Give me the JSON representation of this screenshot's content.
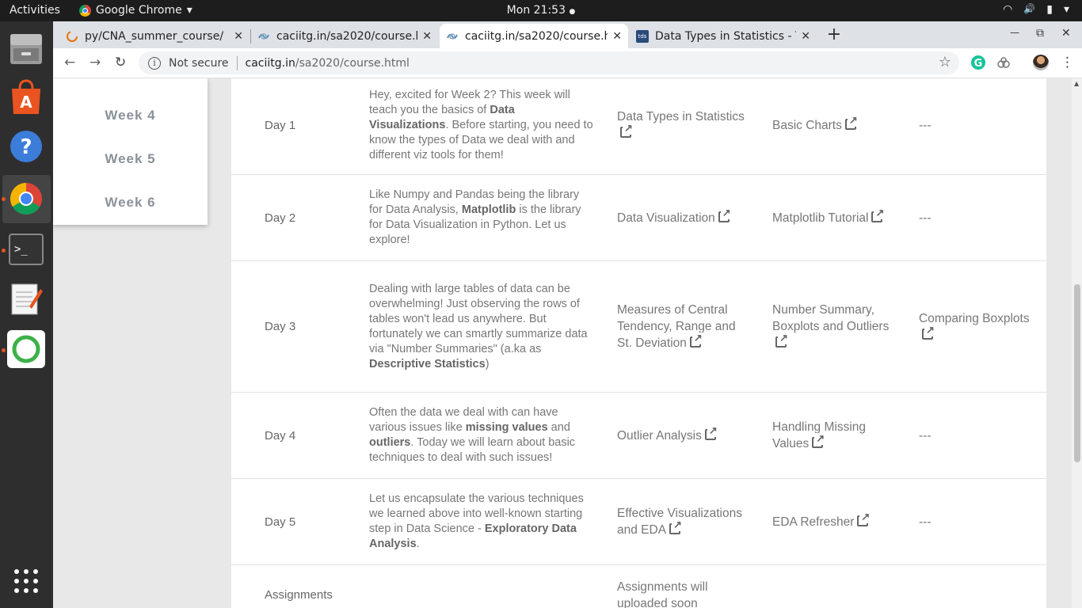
{
  "topbar": {
    "activities": "Activities",
    "app_name": "Google Chrome",
    "app_arrow": "▾",
    "clock": "Mon 21:53",
    "dot": "●",
    "wifi": "◠",
    "volume": "🔊",
    "battery": "▮",
    "menu": "▾"
  },
  "dock": {
    "items": [
      "files-icon",
      "software-center-icon",
      "help-icon",
      "chrome-icon",
      "terminal-icon",
      "text-editor-icon",
      "anaconda-icon"
    ],
    "apps_grid": "⋮⋮⋮"
  },
  "tabs": [
    {
      "title": "py/CNA_summer_course/",
      "close": "✕"
    },
    {
      "title": "caciitg.in/sa2020/course.h",
      "close": "✕"
    },
    {
      "title": "caciitg.in/sa2020/course.h",
      "close": "✕"
    },
    {
      "title": "Data Types in Statistics - T",
      "close": "✕",
      "favicon_text": "tds"
    }
  ],
  "window": {
    "new_tab": "+",
    "minimize": "—",
    "maximize": "⧉",
    "close": "✕"
  },
  "toolbar": {
    "back": "←",
    "forward": "→",
    "reload": "↻",
    "info": "i",
    "not_secure": "Not secure",
    "url_host": "caciitg.in",
    "url_path": "/sa2020/course.html",
    "star": "☆",
    "menu": "⋮"
  },
  "sidebar": {
    "weeks": [
      "Week 4",
      "Week 5",
      "Week 6"
    ]
  },
  "table": {
    "rows": [
      {
        "day": "Day 1",
        "desc_parts": [
          "Hey, excited for Week 2? This week will teach you the basics of ",
          "Data Visualizations",
          ". Before starting, you need to know the types of Data we deal with and different viz tools for them!"
        ],
        "link1": "Data Types in Statistics",
        "link2": "Basic Charts",
        "link3": "---"
      },
      {
        "day": "Day 2",
        "desc_parts": [
          "Like Numpy and Pandas being the library for Data Analysis, ",
          "Matplotlib",
          " is the library for Data Visualization in Python. Let us explore!"
        ],
        "link1": "Data Visualization",
        "link2": "Matplotlib Tutorial",
        "link3": "---"
      },
      {
        "day": "Day 3",
        "desc_parts": [
          "Dealing with large tables of data can be overwhelming! Just observing the rows of tables won't lead us anywhere. But fortunately we can smartly summarize data via \"Number Summaries\" (a.ka as ",
          "Descriptive Statistics",
          ")"
        ],
        "link1": "Measures of Central Tendency, Range and St. Deviation",
        "link2": "Number Summary, Boxplots and Outliers",
        "link3": "Comparing Boxplots"
      },
      {
        "day": "Day 4",
        "desc_parts": [
          "Often the data we deal with can have various issues like ",
          "missing values",
          " and ",
          "outliers",
          ". Today we will learn about basic techniques to deal with such issues!"
        ],
        "link1": "Outlier Analysis",
        "link2": "Handling Missing Values",
        "link3": "---"
      },
      {
        "day": "Day 5",
        "desc_parts": [
          "Let us encapsulate the various techniques we learned above into well-known starting step in Data Science - ",
          "Exploratory Data Analysis",
          "."
        ],
        "link1": "Effective Visualizations and EDA",
        "link2": "EDA Refresher",
        "link3": "---"
      },
      {
        "day": "Assignments",
        "link1": "Assignments will uploaded soon"
      }
    ]
  }
}
